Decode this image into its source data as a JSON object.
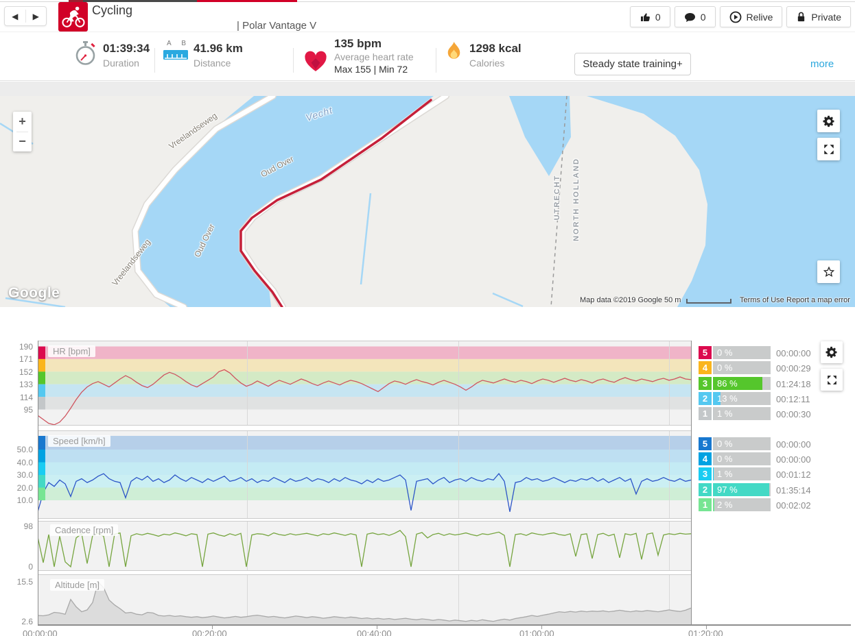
{
  "icons": {
    "prev": "◀",
    "next": "▶"
  },
  "header": {
    "sport_label": "Cycling",
    "device_label": "| Polar Vantage V",
    "likes_count": "0",
    "comments_count": "0",
    "relive_label": "Relive",
    "privacy_label": "Private",
    "accent_red": "#d10027"
  },
  "stats": {
    "duration": {
      "value": "01:39:34",
      "label": "Duration"
    },
    "distance": {
      "value": "41.96 km",
      "label": "Distance",
      "a": "A",
      "b": "B"
    },
    "heart_rate": {
      "value": "135 bpm",
      "label": "Average heart rate",
      "max_min": "Max 155  |  Min 72"
    },
    "calories": {
      "value": "1298 kcal",
      "label": "Calories"
    },
    "training_benefit": "Steady state training+",
    "more_link": "more"
  },
  "map": {
    "water_color": "#a5d7f6",
    "land_color": "#f0efec",
    "route_color": "#c5203a",
    "labels": {
      "river": "Vecht",
      "road1": "Vreelandseweg",
      "road2": "Vreelandseweg",
      "road3": "Oud Over",
      "road4": "Oud Over",
      "boundary1": "UTRECHT",
      "boundary2": "NORTH HOLLAND"
    },
    "controls": {
      "zoom_in": "+",
      "zoom_out": "−"
    },
    "google_logo": "Google",
    "attribution": {
      "map_data": "Map data ©2019 Google",
      "scale": "50 m",
      "terms": "Terms of Use",
      "report": "Report a map error"
    }
  },
  "charts": {
    "x_labels": [
      "00:00:00",
      "00:20:00",
      "00:40:00",
      "01:00:00",
      "01:20:00"
    ],
    "hr": {
      "title": "HR [bpm]",
      "ticks": [
        "190",
        "171",
        "152",
        "133",
        "114",
        "95"
      ],
      "line_color": "#cf5560",
      "band_colors": [
        "#f0b4c8",
        "#f3e5bb",
        "#d4eac5",
        "#c6e5f2",
        "#e0e2e2"
      ],
      "chip_colors": [
        "#dc0a4e",
        "#fab51d",
        "#55c62c",
        "#54c8f0",
        "#c3c7c9"
      ],
      "series": [
        86,
        80,
        74,
        72,
        76,
        85,
        97,
        110,
        121,
        129,
        134,
        137,
        133,
        129,
        135,
        141,
        146,
        142,
        136,
        131,
        128,
        133,
        140,
        147,
        151,
        148,
        143,
        137,
        132,
        129,
        134,
        139,
        144,
        152,
        155,
        150,
        142,
        135,
        130,
        133,
        138,
        134,
        130,
        135,
        139,
        136,
        133,
        137,
        141,
        138,
        134,
        131,
        135,
        138,
        135,
        132,
        136,
        139,
        137,
        134,
        130,
        126,
        122,
        128,
        134,
        138,
        136,
        133,
        137,
        140,
        137,
        135,
        132,
        136,
        139,
        136,
        133,
        129,
        124,
        129,
        135,
        139,
        137,
        135,
        138,
        141,
        138,
        136,
        139,
        137,
        134,
        138,
        141,
        139,
        136,
        139,
        142,
        139,
        137,
        140,
        138,
        135,
        139,
        141,
        138,
        136,
        140,
        143,
        140,
        138,
        141,
        139,
        137,
        140,
        142,
        139,
        141,
        144,
        141,
        140
      ]
    },
    "speed": {
      "title": "Speed [km/h]",
      "ticks": [
        "50.0",
        "40.0",
        "30.0",
        "20.0",
        "10.0"
      ],
      "line_color": "#2c55c8",
      "band_colors": [
        "#b6cfe9",
        "#bedff2",
        "#c4ebf4",
        "#cbeff3",
        "#cfeed6"
      ],
      "chip_colors": [
        "#1878cf",
        "#00a2e2",
        "#19ccf2",
        "#43d9c5",
        "#77e593"
      ],
      "series": [
        1,
        16,
        24,
        21,
        26,
        23,
        13,
        25,
        27,
        24,
        26,
        29,
        31,
        27,
        25,
        24,
        12,
        25,
        28,
        26,
        29,
        25,
        27,
        24,
        26,
        30,
        27,
        25,
        28,
        26,
        24,
        27,
        25,
        27,
        29,
        25,
        26,
        28,
        25,
        27,
        24,
        26,
        25,
        28,
        26,
        24,
        27,
        25,
        26,
        28,
        25,
        27,
        26,
        24,
        27,
        25,
        28,
        26,
        25,
        23,
        26,
        24,
        27,
        25,
        26,
        28,
        30,
        26,
        2,
        25,
        26,
        27,
        23,
        26,
        28,
        24,
        26,
        27,
        25,
        28,
        26,
        25,
        27,
        26,
        31,
        25,
        1,
        24,
        25,
        28,
        26,
        27,
        25,
        26,
        28,
        26,
        24,
        26,
        25,
        27,
        26,
        28,
        25,
        27,
        24,
        26,
        28,
        25,
        27,
        15,
        25,
        27,
        25,
        26,
        28,
        26,
        25,
        27,
        25,
        26
      ]
    },
    "cadence": {
      "title": "Cadence [rpm]",
      "ticks": [
        "98",
        "0"
      ],
      "line_color": "#76a53f",
      "series": [
        72,
        10,
        78,
        0,
        74,
        12,
        0,
        70,
        80,
        8,
        76,
        81,
        74,
        0,
        79,
        82,
        0,
        75,
        80,
        77,
        81,
        78,
        74,
        79,
        77,
        82,
        79,
        75,
        80,
        78,
        0,
        79,
        82,
        77,
        74,
        80,
        76,
        81,
        0,
        77,
        80,
        79,
        75,
        82,
        78,
        76,
        80,
        77,
        79,
        81,
        78,
        75,
        80,
        78,
        82,
        79,
        76,
        80,
        77,
        0,
        79,
        82,
        78,
        80,
        76,
        81,
        88,
        73,
        0,
        79,
        83,
        70,
        78,
        81,
        76,
        80,
        77,
        79,
        82,
        78,
        75,
        80,
        78,
        81,
        84,
        76,
        0,
        78,
        80,
        76,
        82,
        79,
        77,
        80,
        82,
        78,
        76,
        80,
        25,
        78,
        80,
        20,
        78,
        81,
        75,
        79,
        22,
        80,
        77,
        81,
        18,
        79,
        82,
        28,
        77,
        80,
        78,
        81,
        79,
        80
      ]
    },
    "altitude": {
      "title": "Altitude [m]",
      "ticks": [
        "15.5",
        "2.6"
      ],
      "line_color": "#a8a8a8",
      "fill_color": "#dcdcdc",
      "series": [
        4.6,
        4.5,
        4.8,
        5.6,
        5.4,
        5.0,
        9.8,
        7.4,
        5.8,
        6.4,
        8.8,
        15.5,
        13.6,
        9.6,
        8.0,
        6.8,
        5.4,
        5.6,
        5.0,
        4.8,
        5.6,
        5.4,
        4.6,
        4.4,
        4.6,
        4.3,
        4.5,
        4.2,
        4.0,
        4.2,
        3.9,
        4.1,
        4.4,
        4.1,
        3.8,
        4.0,
        4.3,
        4.0,
        4.2,
        4.5,
        4.7,
        4.4,
        4.1,
        4.3,
        4.0,
        3.8,
        4.1,
        4.4,
        4.2,
        3.9,
        4.2,
        4.0,
        3.7,
        3.9,
        4.2,
        4.0,
        3.8,
        4.1,
        3.9,
        3.6,
        3.8,
        3.5,
        3.7,
        3.4,
        3.6,
        3.3,
        3.5,
        3.7,
        3.4,
        3.2,
        3.5,
        3.3,
        3.0,
        3.3,
        3.1,
        2.8,
        3.1,
        2.9,
        2.7,
        3.0,
        2.8,
        3.2,
        2.9,
        2.7,
        3.1,
        3.4,
        3.1,
        3.6,
        3.9,
        4.2,
        4.6,
        4.3,
        4.7,
        5.0,
        5.4,
        5.8,
        5.6,
        5.9,
        5.7,
        6.0,
        5.8,
        6.0,
        5.9,
        6.1,
        5.8,
        6.0,
        6.3,
        6.0,
        5.8,
        6.1,
        5.9,
        6.2,
        6.0,
        5.8,
        6.1,
        6.4,
        6.1,
        5.9,
        6.3,
        7.0
      ]
    },
    "hr_zones": [
      {
        "zone": "5",
        "color": "#dc0a4e",
        "pct": "0 %",
        "pct_value": 0,
        "time": "00:00:00"
      },
      {
        "zone": "4",
        "color": "#fab51d",
        "pct": "0 %",
        "pct_value": 0,
        "time": "00:00:29"
      },
      {
        "zone": "3",
        "color": "#55c62c",
        "pct": "86 %",
        "pct_value": 86,
        "time": "01:24:18"
      },
      {
        "zone": "2",
        "color": "#54c8f0",
        "pct": "13 %",
        "pct_value": 13,
        "time": "00:12:11"
      },
      {
        "zone": "1",
        "color": "#c3c7c9",
        "pct": "1 %",
        "pct_value": 1,
        "time": "00:00:30"
      }
    ],
    "speed_zones": [
      {
        "zone": "5",
        "color": "#1878cf",
        "pct": "0 %",
        "pct_value": 0,
        "time": "00:00:00"
      },
      {
        "zone": "4",
        "color": "#00a2e2",
        "pct": "0 %",
        "pct_value": 0,
        "time": "00:00:00"
      },
      {
        "zone": "3",
        "color": "#19ccf2",
        "pct": "1 %",
        "pct_value": 1,
        "time": "00:01:12"
      },
      {
        "zone": "2",
        "color": "#43d9c5",
        "pct": "97 %",
        "pct_value": 97,
        "time": "01:35:14"
      },
      {
        "zone": "1",
        "color": "#77e593",
        "pct": "2 %",
        "pct_value": 2,
        "time": "00:02:02"
      }
    ]
  }
}
